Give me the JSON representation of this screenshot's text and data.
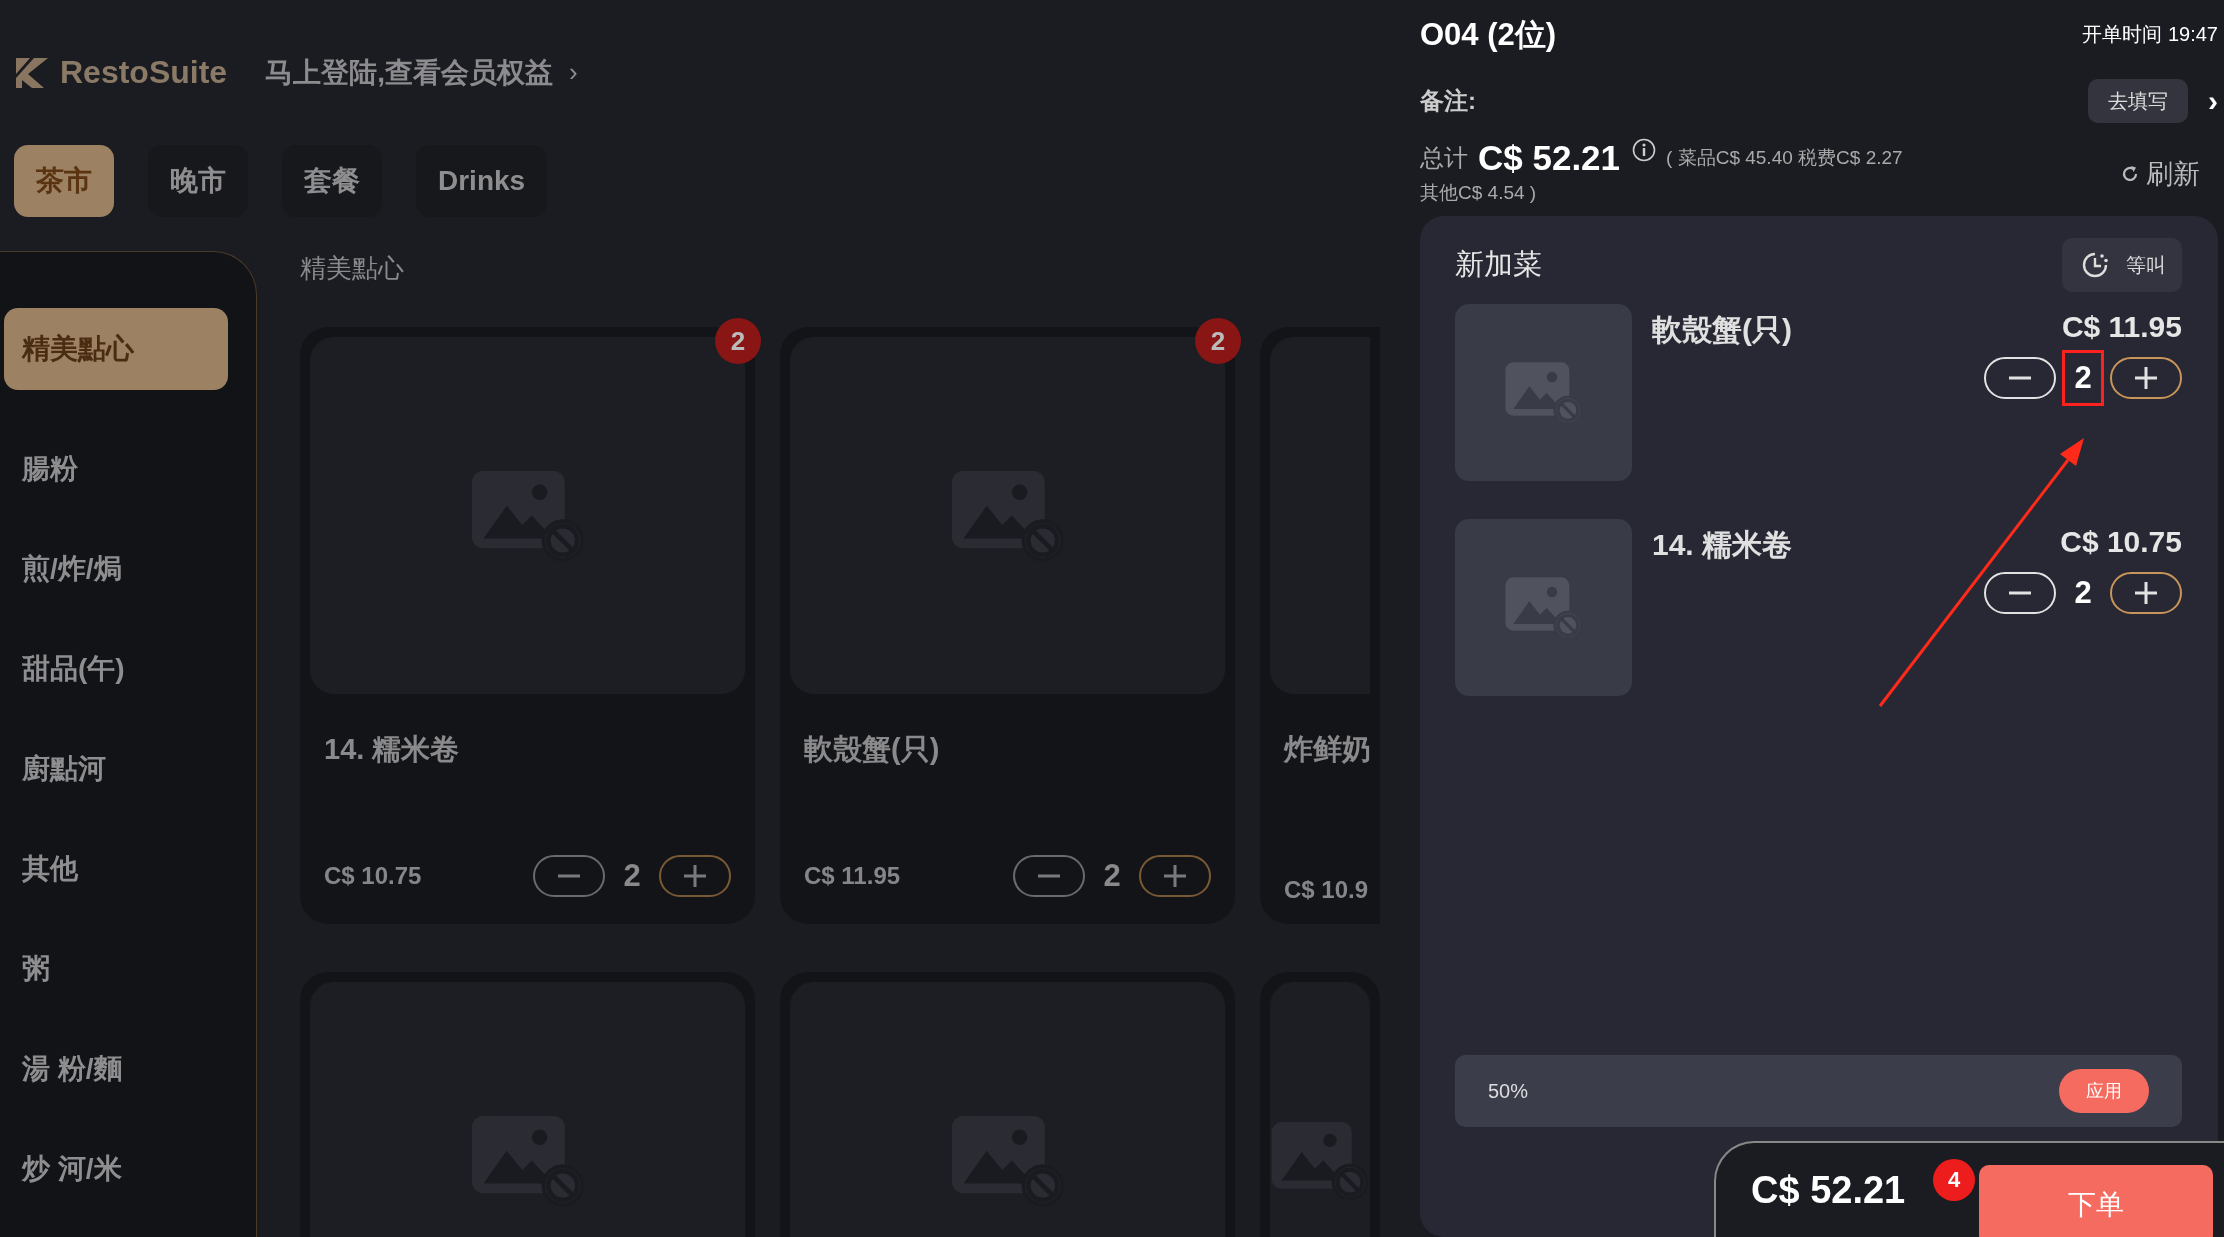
{
  "header": {
    "brand": "RestoSuite",
    "login_prompt": "马上登陆,查看会员权益",
    "chevron": "›"
  },
  "menu_tabs": [
    {
      "label": "茶市",
      "selected": true
    },
    {
      "label": "晚市",
      "selected": false
    },
    {
      "label": "套餐",
      "selected": false
    },
    {
      "label": "Drinks",
      "selected": false
    }
  ],
  "categories": [
    {
      "label": "精美點心",
      "selected": true
    },
    {
      "label": "腸粉",
      "selected": false
    },
    {
      "label": "煎/炸/焗",
      "selected": false
    },
    {
      "label": "甜品(午)",
      "selected": false
    },
    {
      "label": "廚點河",
      "selected": false
    },
    {
      "label": "其他",
      "selected": false
    },
    {
      "label": "粥",
      "selected": false
    },
    {
      "label": "湯 粉/麵",
      "selected": false
    },
    {
      "label": "炒 河/米",
      "selected": false
    }
  ],
  "section_title": "精美點心",
  "dishes": [
    {
      "kind": "full",
      "name": "14. 糯米卷",
      "price": "C$ 10.75",
      "quantity": "2",
      "badge": "2"
    },
    {
      "kind": "full",
      "name": "軟殼蟹(只)",
      "price": "C$ 11.95",
      "quantity": "2",
      "badge": "2"
    },
    {
      "kind": "partial",
      "name": "炸鲜奶",
      "price": "C$ 10.9"
    },
    {
      "kind": "image_only"
    },
    {
      "kind": "image_only"
    },
    {
      "kind": "image_only"
    }
  ],
  "order": {
    "table": "O04 (2位)",
    "open_time": "开单时间 19:47",
    "note_label": "备注:",
    "note_button": "去填写",
    "note_chevron": "›",
    "total_label": "总计",
    "total": "C$ 52.21",
    "breakdown": [
      "( 菜品C$ 45.40 税费C$ 2.27",
      "其他C$ 4.54 )"
    ],
    "refresh": "刷新",
    "new_items_title": "新加菜",
    "hold_button": "等叫",
    "items": [
      {
        "name": "軟殼蟹(只)",
        "price": "C$ 11.95",
        "quantity": "2",
        "annotated": true
      },
      {
        "name": "14. 糯米卷",
        "price": "C$ 10.75",
        "quantity": "2",
        "annotated": false
      }
    ],
    "discount": "50%",
    "apply_button": "应用"
  },
  "checkout": {
    "total": "C$ 52.21",
    "count": "4",
    "submit": "下单"
  }
}
